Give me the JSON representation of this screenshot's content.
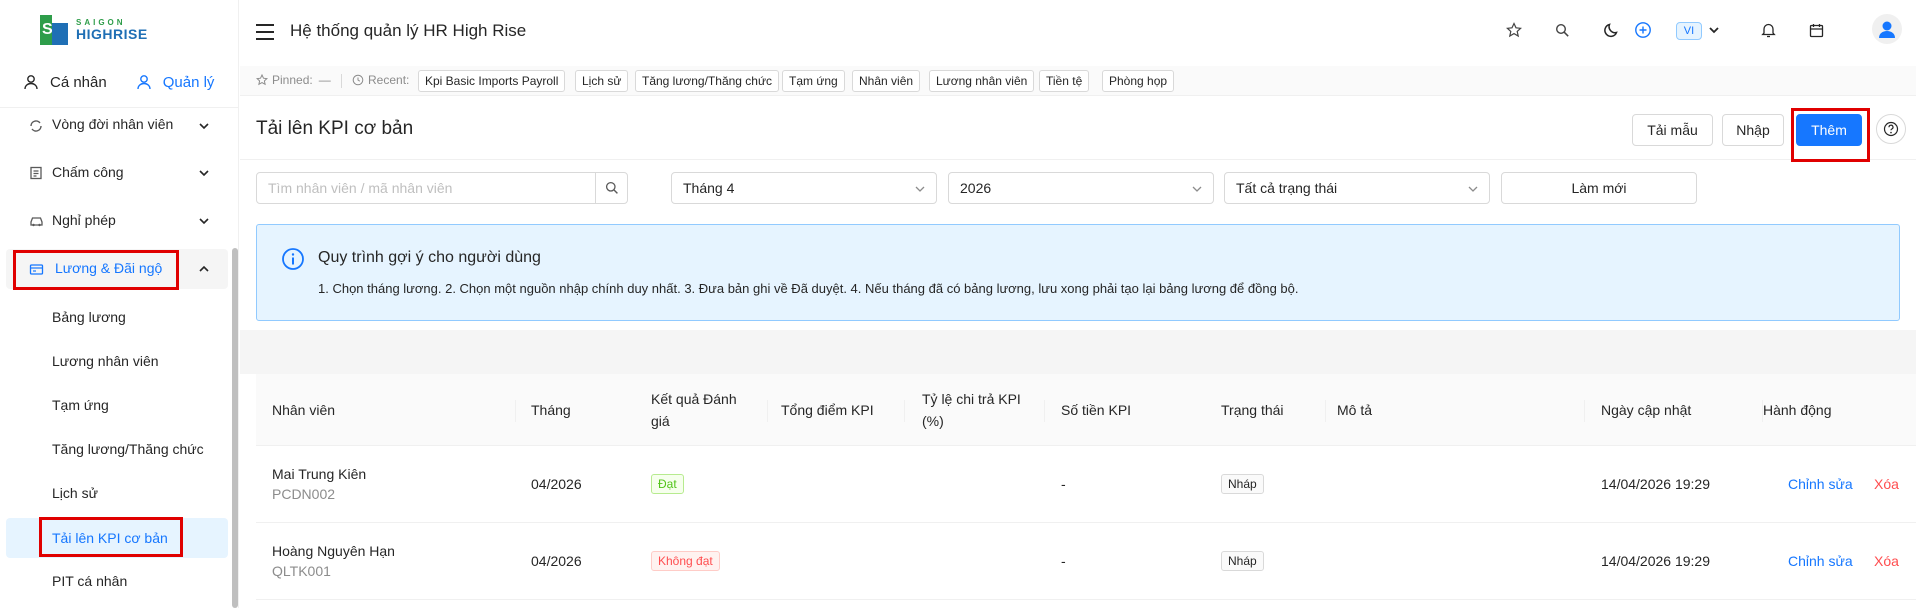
{
  "app": {
    "logo_top": "SAIGON",
    "logo_bottom": "HIGHRISE",
    "title": "Hệ thống quản lý HR High Rise",
    "language": "VI"
  },
  "role_tabs": {
    "personal": "Cá nhân",
    "manage": "Quản lý"
  },
  "sidebar": {
    "groups": [
      {
        "label": "Vòng đời nhân viên",
        "icon": "cycle-icon"
      },
      {
        "label": "Chấm công",
        "icon": "clipboard-icon"
      },
      {
        "label": "Nghỉ phép",
        "icon": "car-icon"
      },
      {
        "label": "Lương & Đãi ngộ",
        "icon": "wallet-icon"
      }
    ],
    "sub_items": [
      {
        "label": "Bảng lương"
      },
      {
        "label": "Lương nhân viên"
      },
      {
        "label": "Tạm ứng"
      },
      {
        "label": "Tăng lương/Thăng chức"
      },
      {
        "label": "Lịch sử"
      },
      {
        "label": "Tải lên KPI cơ bản"
      },
      {
        "label": "PIT cá nhân"
      }
    ]
  },
  "pinbar": {
    "pinned_label": "Pinned:",
    "pinned_value": "—",
    "recent_label": "Recent:",
    "recent": [
      "Kpi Basic Imports Payroll",
      "Lịch sử",
      "Tăng lương/Thăng chức",
      "Tạm ứng",
      "Nhân viên",
      "Lương nhân viên",
      "Tiền tệ",
      "Phòng họp"
    ]
  },
  "page": {
    "title": "Tải lên KPI cơ bản",
    "btn_template": "Tải mẫu",
    "btn_import": "Nhập",
    "btn_add": "Thêm"
  },
  "filters": {
    "search_placeholder": "Tìm nhân viên / mã nhân viên",
    "month": "Tháng 4",
    "year": "2026",
    "status": "Tất cả trạng thái",
    "refresh": "Làm mới"
  },
  "info": {
    "title": "Quy trình gợi ý cho người dùng",
    "desc": "1. Chọn tháng lương. 2. Chọn một nguồn nhập chính duy nhất. 3. Đưa bản ghi về Đã duyệt. 4. Nếu tháng đã có bảng lương, lưu xong phải tạo lại bảng lương để đồng bộ."
  },
  "table": {
    "headers": {
      "employee": "Nhân viên",
      "month": "Tháng",
      "result_1": "Kết quả Đánh",
      "result_2": "giá",
      "total": "Tổng điểm KPI",
      "rate_1": "Tỷ lệ chi trả KPI",
      "rate_2": "(%)",
      "amount": "Số tiền KPI",
      "status": "Trạng thái",
      "desc": "Mô tả",
      "updated": "Ngày cập nhật",
      "action": "Hành động"
    },
    "rows": [
      {
        "name": "Mai Trung Kiên",
        "code": "PCDN002",
        "month": "04/2026",
        "result": "Đạt",
        "amount": "-",
        "status": "Nháp",
        "updated": "14/04/2026 19:29",
        "edit": "Chỉnh sửa",
        "delete": "Xóa"
      },
      {
        "name": "Hoàng Nguyên Hạn",
        "code": "QLTK001",
        "month": "04/2026",
        "result": "Không đạt",
        "amount": "-",
        "status": "Nháp",
        "updated": "14/04/2026 19:29",
        "edit": "Chỉnh sửa",
        "delete": "Xóa"
      }
    ]
  },
  "colors": {
    "primary": "#1677ff",
    "danger": "#ff4d4f",
    "success": "#52c41a",
    "highlight": "#e00000"
  }
}
